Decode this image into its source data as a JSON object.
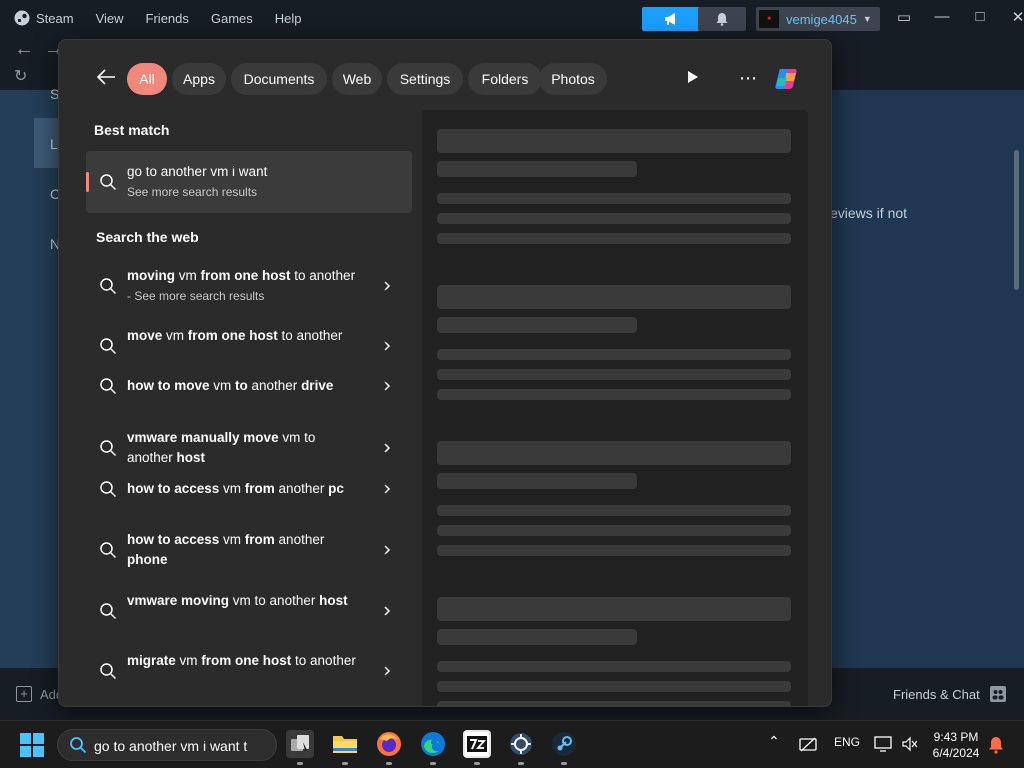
{
  "steam": {
    "menu": [
      "Steam",
      "View",
      "Friends",
      "Games",
      "Help"
    ],
    "username": "vemige4045",
    "right_text": "eviews if not",
    "side_letters": [
      "S",
      "L",
      "C",
      "N"
    ],
    "friends_chat": "Friends & Chat",
    "add_game": "Add"
  },
  "search_panel": {
    "filters": [
      "All",
      "Apps",
      "Documents",
      "Web",
      "Settings",
      "Folders",
      "Photos"
    ],
    "active_filter": "All",
    "best_match_title": "Best match",
    "best_match": {
      "title": "go to another vm i want",
      "subtitle": "See more search results"
    },
    "web_title": "Search the web",
    "web_results": [
      {
        "segments": [
          {
            "t": "moving",
            "b": true
          },
          {
            "t": " vm ",
            "b": false
          },
          {
            "t": "from one host",
            "b": true
          },
          {
            "t": " to another",
            "b": false
          }
        ],
        "sub": " - See more search results"
      },
      {
        "segments": [
          {
            "t": "move",
            "b": true
          },
          {
            "t": " vm ",
            "b": false
          },
          {
            "t": "from one host",
            "b": true
          },
          {
            "t": " to another",
            "b": false
          }
        ],
        "sub": ""
      },
      {
        "segments": [
          {
            "t": "how to move",
            "b": true
          },
          {
            "t": " vm ",
            "b": false
          },
          {
            "t": "to",
            "b": true
          },
          {
            "t": " another ",
            "b": false
          },
          {
            "t": "drive",
            "b": true
          }
        ],
        "sub": ""
      },
      {
        "segments": [
          {
            "t": "vmware manually move",
            "b": true
          },
          {
            "t": " vm to another ",
            "b": false
          },
          {
            "t": "host",
            "b": true
          }
        ],
        "sub": ""
      },
      {
        "segments": [
          {
            "t": "how to access",
            "b": true
          },
          {
            "t": " vm ",
            "b": false
          },
          {
            "t": "from",
            "b": true
          },
          {
            "t": " another ",
            "b": false
          },
          {
            "t": "pc",
            "b": true
          }
        ],
        "sub": ""
      },
      {
        "segments": [
          {
            "t": "how to access",
            "b": true
          },
          {
            "t": " vm ",
            "b": false
          },
          {
            "t": "from",
            "b": true
          },
          {
            "t": " another ",
            "b": false
          },
          {
            "t": "phone",
            "b": true
          }
        ],
        "sub": ""
      },
      {
        "segments": [
          {
            "t": "vmware moving",
            "b": true
          },
          {
            "t": " vm to another ",
            "b": false
          },
          {
            "t": "host",
            "b": true
          }
        ],
        "sub": ""
      },
      {
        "segments": [
          {
            "t": "migrate",
            "b": true
          },
          {
            "t": " vm ",
            "b": false
          },
          {
            "t": "from one host",
            "b": true
          },
          {
            "t": " to another",
            "b": false
          }
        ],
        "sub": ""
      }
    ]
  },
  "taskbar": {
    "search_text": "go to another vm i want t",
    "language": "ENG",
    "time": "9:43 PM",
    "date": "6/4/2024",
    "apps": [
      "search-app",
      "file-explorer",
      "firefox",
      "edge",
      "7zip",
      "gear-app",
      "steam"
    ]
  },
  "colors": {
    "accent": "#f0887b",
    "steam_blue": "#1a9fff",
    "panel_bg": "#2b2b2b"
  }
}
